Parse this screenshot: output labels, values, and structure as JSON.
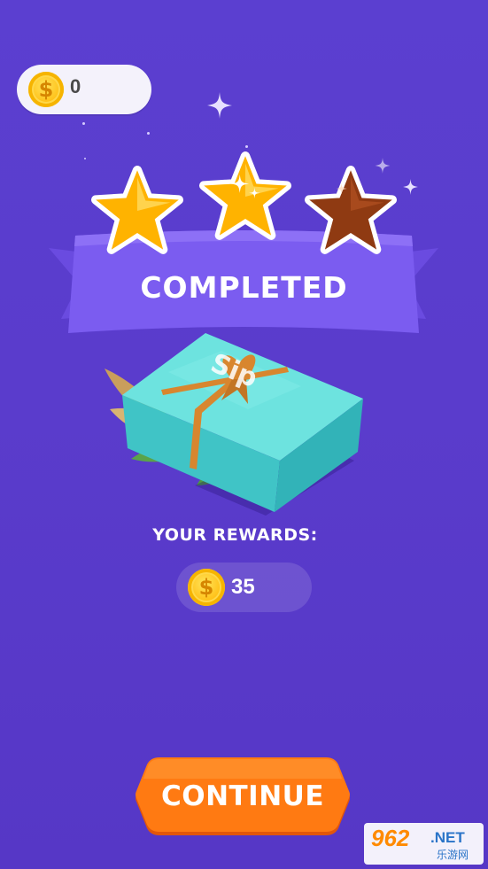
{
  "hud": {
    "coins": "0",
    "coin_symbol": "$"
  },
  "result": {
    "title": "COMPLETED",
    "stars_earned": 2,
    "stars_total": 3
  },
  "gift": {
    "box_text": "Sip"
  },
  "rewards": {
    "label": "YOUR REWARDS:",
    "amount": "35",
    "coin_symbol": "$"
  },
  "actions": {
    "continue_label": "CONTINUE"
  },
  "watermark": {
    "main": "962",
    "suffix": ".NET",
    "sub": "乐游网"
  },
  "colors": {
    "background": "#5a3ccc",
    "ribbon": "#7b5cf0",
    "star_gold": "#ffb300",
    "star_bronze": "#9a3f14",
    "gift_box": "#53d6d4",
    "ribbon_bow": "#d8862e",
    "button": "#ff7a12"
  },
  "icons": [
    "coin-icon",
    "star-icon",
    "sparkle-icon",
    "gift-box-icon",
    "leaf-icon"
  ]
}
